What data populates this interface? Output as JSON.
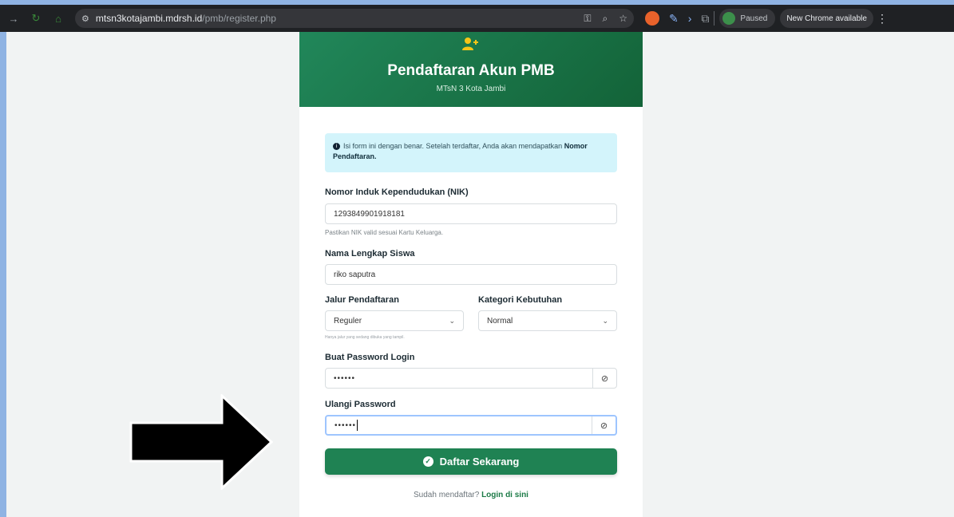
{
  "browser": {
    "url_host": "mtsn3kotajambi.mdrsh.id",
    "url_path": "/pmb/register.php",
    "paused_label": "Paused",
    "new_chrome_label": "New Chrome available"
  },
  "header": {
    "title": "Pendaftaran Akun PMB",
    "subtitle": "MTsN 3 Kota Jambi"
  },
  "alert": {
    "text": "Isi form ini dengan benar. Setelah terdaftar, Anda akan mendapatkan",
    "bold": "Nomor Pendaftaran."
  },
  "form": {
    "nik_label": "Nomor Induk Kependudukan (NIK)",
    "nik_value": "1293849901918181",
    "nik_hint": "Pastikan NIK valid sesuai Kartu Keluarga.",
    "name_label": "Nama Lengkap Siswa",
    "name_value": "riko saputra",
    "jalur_label": "Jalur Pendaftaran",
    "jalur_value": "Reguler",
    "jalur_hint": "Hanya jalur yang sedang dibuka yang tampil.",
    "kategori_label": "Kategori Kebutuhan",
    "kategori_value": "Normal",
    "password_label": "Buat Password Login",
    "password_value": "••••••",
    "repeat_label": "Ulangi Password",
    "repeat_value": "••••••",
    "submit_label": "Daftar Sekarang"
  },
  "footer": {
    "question": "Sudah mendaftar?",
    "login_link": "Login di sini"
  },
  "colors": {
    "primary": "#1f8253",
    "alert_bg": "#d3f4fb"
  }
}
